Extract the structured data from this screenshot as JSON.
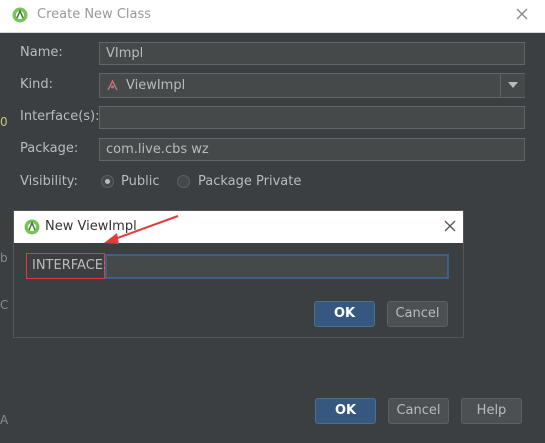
{
  "window": {
    "title": "Create New Class"
  },
  "form": {
    "name_label": "Name:",
    "name_value": "VImpl",
    "kind_label": "Kind:",
    "kind_value": "ViewImpl",
    "interfaces_label": "Interface(s):",
    "interfaces_value": "",
    "package_label": "Package:",
    "package_value": "com.live.cbs wz",
    "visibility_label": "Visibility:",
    "visibility_options": [
      "Public",
      "Package Private"
    ],
    "visibility_selected": "Public"
  },
  "buttons": {
    "ok": "OK",
    "cancel": "Cancel",
    "help": "Help"
  },
  "inner_dialog": {
    "title": "New ViewImpl",
    "field_label": "INTERFACE:",
    "field_value": "",
    "ok": "OK",
    "cancel": "Cancel"
  },
  "edge_glyphs": [
    "0",
    "b",
    "C",
    "A"
  ],
  "colors": {
    "background": "#3c3f41",
    "annotation": "#e03c3c",
    "focus": "#3d6185",
    "logo": "#78c257"
  }
}
